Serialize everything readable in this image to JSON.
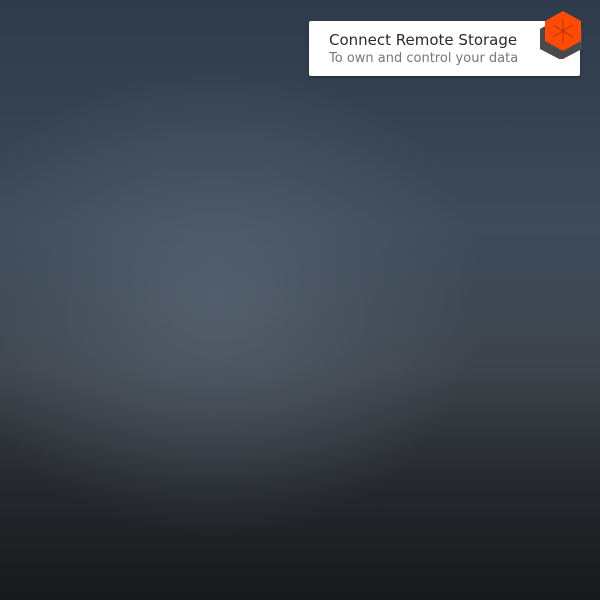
{
  "widget": {
    "title": "Connect Remote Storage",
    "subtitle": "To own and control your data",
    "logo_icon": "remotestorage-cube-icon",
    "accent_color": "#ff4b03",
    "logo_shadow_color": "#4a4a4a"
  }
}
